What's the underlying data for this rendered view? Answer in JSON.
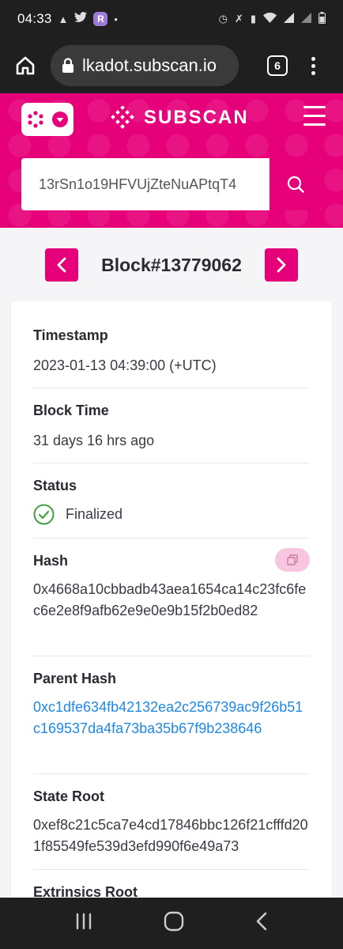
{
  "status_bar": {
    "time": "04:33",
    "left_icons": [
      "upload-icon",
      "twitter-icon",
      "r-app-icon",
      "dot-icon"
    ],
    "right_icons": [
      "alarm-icon",
      "mute-icon",
      "battery-saver-icon",
      "wifi-icon",
      "signal-icon",
      "signal-icon-2",
      "battery-icon"
    ]
  },
  "browser": {
    "url": "lkadot.subscan.io",
    "tab_count": "6"
  },
  "header": {
    "logo_text": "SUBSCAN",
    "search_value": "13rSn1o19HFVUjZteNuAPtqT4"
  },
  "block": {
    "title": "Block#13779062"
  },
  "fields": {
    "timestamp_label": "Timestamp",
    "timestamp_value": "2023-01-13 04:39:00 (+UTC)",
    "block_time_label": "Block Time",
    "block_time_value": "31 days 16 hrs ago",
    "status_label": "Status",
    "status_value": "Finalized",
    "hash_label": "Hash",
    "hash_value": "0x4668a10cbbadb43aea1654ca14c23fc6fec6e2e8f9afb62e9e0e9b15f2b0ed82",
    "parent_hash_label": "Parent Hash",
    "parent_hash_value": "0xc1dfe634fb42132ea2c256739ac9f26b51c169537da4fa73ba35b67f9b238646",
    "state_root_label": "State Root",
    "state_root_value": "0xef8c21c5ca7e4cd17846bbc126f21cfffd201f85549fe539d3efd990f6e49a73",
    "extrinsics_root_label": "Extrinsics Root"
  },
  "colors": {
    "brand": "#e6007a",
    "link": "#1e88e5",
    "success": "#43a047"
  }
}
